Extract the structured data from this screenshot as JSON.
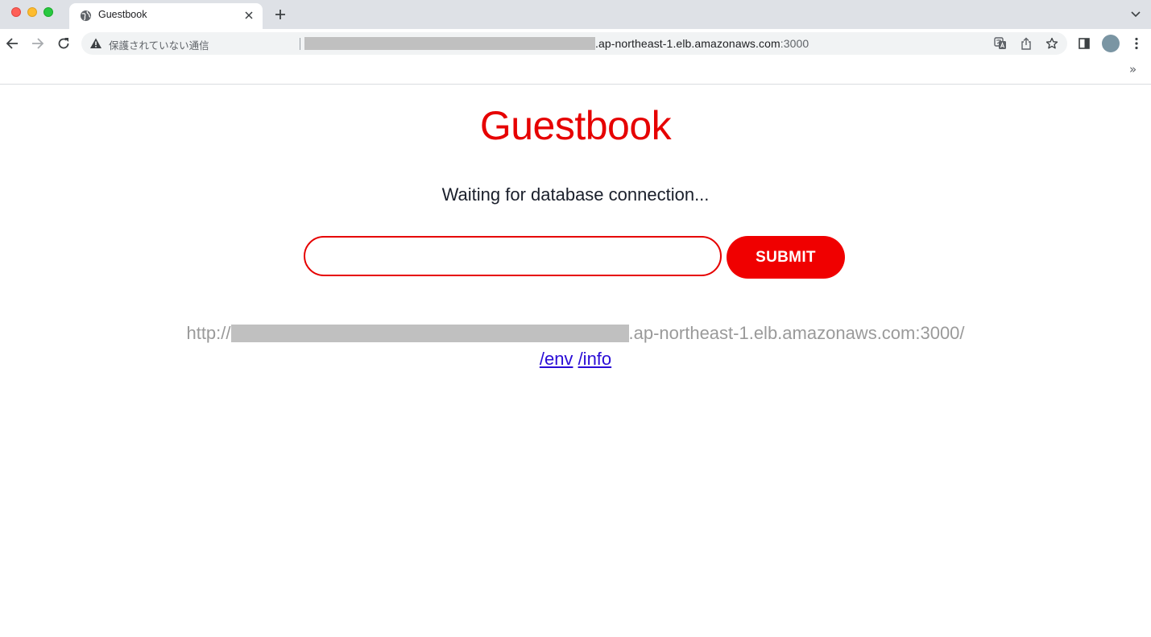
{
  "browser": {
    "tab_title": "Guestbook",
    "security_label": "保護されていない通信",
    "url_host_suffix": ".ap-northeast-1.elb.amazonaws.com",
    "url_port": ":3000",
    "bookmarks_overflow": "»"
  },
  "colors": {
    "accent": "#e60000",
    "submit": "#f00000",
    "link": "#2a0cd6",
    "redaction": "#c0c0c0"
  },
  "page": {
    "title": "Guestbook",
    "status": "Waiting for database connection...",
    "input_value": "",
    "submit_label": "SUBMIT",
    "host_prefix": "http://",
    "host_suffix": ".ap-northeast-1.elb.amazonaws.com:3000/",
    "links": [
      {
        "label": "/env"
      },
      {
        "label": "/info"
      }
    ]
  }
}
